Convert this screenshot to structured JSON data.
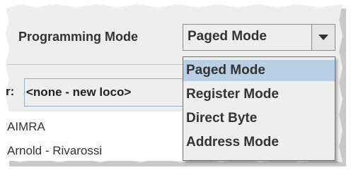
{
  "programming_mode": {
    "label": "Programming Mode",
    "selected": "Paged Mode",
    "options": [
      "Paged Mode",
      "Register Mode",
      "Direct Byte",
      "Address Mode"
    ],
    "highlighted_option": "Paged Mode"
  },
  "roster": {
    "label_fragment": "r:",
    "selected": "<none - new loco>"
  },
  "manufacturer_list": {
    "items": [
      "AIMRA",
      "Arnold - Rivarossi"
    ]
  },
  "colors": {
    "panel_bg": "#eeeeee",
    "highlight": "#b8cfe5",
    "text": "#333333"
  }
}
